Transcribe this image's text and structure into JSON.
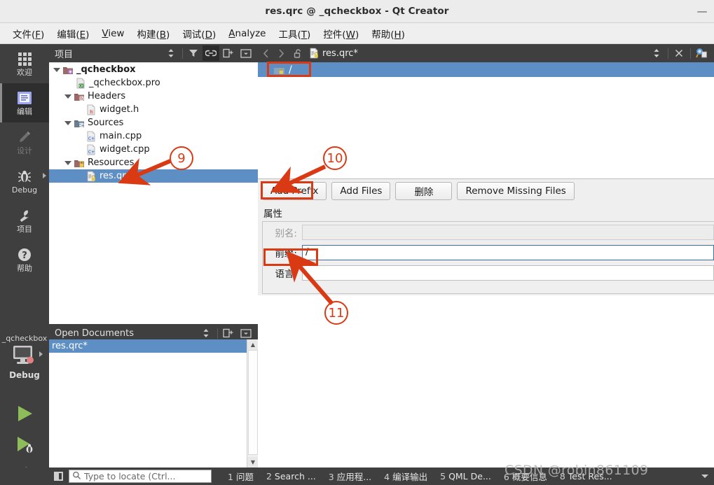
{
  "window": {
    "title": "res.qrc @ _qcheckbox - Qt Creator",
    "minimize_label": "—"
  },
  "menubar": {
    "items": [
      {
        "text": "文件(F)",
        "mnemonic": "F"
      },
      {
        "text": "编辑(E)",
        "mnemonic": "E"
      },
      {
        "text": "View",
        "mnemonic": "V"
      },
      {
        "text": "构建(B)",
        "mnemonic": "B"
      },
      {
        "text": "调试(D)",
        "mnemonic": "D"
      },
      {
        "text": "Analyze",
        "mnemonic": "A"
      },
      {
        "text": "工具(T)",
        "mnemonic": "T"
      },
      {
        "text": "控件(W)",
        "mnemonic": "W"
      },
      {
        "text": "帮助(H)",
        "mnemonic": "H"
      }
    ]
  },
  "modebar": {
    "items": [
      {
        "label": "欢迎",
        "icon": "grid-icon",
        "state": "normal"
      },
      {
        "label": "编辑",
        "icon": "editor-icon",
        "state": "active"
      },
      {
        "label": "设计",
        "icon": "pencil-icon",
        "state": "disabled"
      },
      {
        "label": "Debug",
        "icon": "bug-icon",
        "state": "normal"
      },
      {
        "label": "项目",
        "icon": "wrench-icon",
        "state": "normal"
      },
      {
        "label": "帮助",
        "icon": "question-icon",
        "state": "normal"
      }
    ],
    "kit": {
      "project_name": "_qcheckbox",
      "build_config": "Debug",
      "icon": "desktop-icon"
    },
    "run_buttons": [
      {
        "name": "run-button",
        "icon": "play-icon"
      },
      {
        "name": "debug-button",
        "icon": "play-bug-icon"
      },
      {
        "name": "build-button",
        "icon": "hammer-icon"
      }
    ]
  },
  "project_panel": {
    "title": "项目",
    "toolbar": [
      {
        "name": "sort-selector",
        "icon": "up-down-arrows-icon",
        "active": false
      },
      {
        "name": "filter-button",
        "icon": "filter-icon",
        "active": false
      },
      {
        "name": "sync-with-editor-button",
        "icon": "link-icon",
        "active": true
      },
      {
        "name": "split-button",
        "icon": "split-icon",
        "active": false
      },
      {
        "name": "close-panel-button",
        "icon": "close-split-icon",
        "active": false
      }
    ],
    "tree": [
      {
        "label": "_qcheckbox",
        "depth": 0,
        "icon": "project-folder-icon",
        "expanded": true,
        "bold": true,
        "selected": false
      },
      {
        "label": "_qcheckbox.pro",
        "depth": 1,
        "icon": "qt-pro-file-icon",
        "expanded": null,
        "bold": false,
        "selected": false
      },
      {
        "label": "Headers",
        "depth": 1,
        "icon": "headers-folder-icon",
        "expanded": true,
        "bold": false,
        "selected": false
      },
      {
        "label": "widget.h",
        "depth": 2,
        "icon": "header-file-icon",
        "expanded": null,
        "bold": false,
        "selected": false
      },
      {
        "label": "Sources",
        "depth": 1,
        "icon": "sources-folder-icon",
        "expanded": true,
        "bold": false,
        "selected": false
      },
      {
        "label": "main.cpp",
        "depth": 2,
        "icon": "cpp-file-icon",
        "expanded": null,
        "bold": false,
        "selected": false
      },
      {
        "label": "widget.cpp",
        "depth": 2,
        "icon": "cpp-file-icon",
        "expanded": null,
        "bold": false,
        "selected": false
      },
      {
        "label": "Resources",
        "depth": 1,
        "icon": "resources-folder-icon",
        "expanded": true,
        "bold": false,
        "selected": false
      },
      {
        "label": "res.qrc",
        "depth": 2,
        "icon": "qrc-file-icon",
        "expanded": null,
        "bold": false,
        "selected": true
      }
    ]
  },
  "open_documents": {
    "title": "Open Documents",
    "toolbar": [
      {
        "name": "opendocs-sort-button",
        "icon": "up-down-arrows-icon"
      },
      {
        "name": "opendocs-split-button",
        "icon": "split-icon"
      },
      {
        "name": "opendocs-close-button",
        "icon": "close-split-icon"
      }
    ],
    "documents": [
      {
        "label": "res.qrc*",
        "selected": true
      }
    ]
  },
  "editor": {
    "toolbar": {
      "back_icon": "chevron-left-icon",
      "forward_icon": "chevron-right-icon",
      "lock_icon": "unlocked-icon",
      "file_icon": "qrc-file-icon",
      "filename": "res.qrc*",
      "split_icon": "up-down-arrows-icon",
      "close_icon": "close-icon",
      "extra_icon": "resource-browser-icon"
    },
    "resource_tree": [
      {
        "label": "/",
        "icon": "prefix-folder-icon",
        "selected": true
      }
    ],
    "buttons": [
      {
        "label": "Add Prefix",
        "name": "add-prefix-button",
        "highlighted": true
      },
      {
        "label": "Add Files",
        "name": "add-files-button",
        "highlighted": false
      },
      {
        "label": "删除",
        "name": "remove-button",
        "highlighted": false
      },
      {
        "label": "Remove Missing Files",
        "name": "remove-missing-files-button",
        "highlighted": false
      }
    ],
    "properties": {
      "group_title": "属性",
      "fields": [
        {
          "label": "别名:",
          "value": "",
          "name": "alias-field",
          "disabled": true,
          "focused": false
        },
        {
          "label": "前缀:",
          "value": "/",
          "name": "prefix-field",
          "disabled": false,
          "focused": true
        },
        {
          "label": "语言:",
          "value": "",
          "name": "language-field",
          "disabled": false,
          "focused": false
        }
      ]
    }
  },
  "statusbar": {
    "toggle_sidebar_name": "toggle-sidebar-button",
    "locator": {
      "icon": "search-icon",
      "placeholder": "Type to locate (Ctrl...",
      "value": ""
    },
    "panes": [
      {
        "num": "1",
        "label": "问题"
      },
      {
        "num": "2",
        "label": "Search ..."
      },
      {
        "num": "3",
        "label": "应用程..."
      },
      {
        "num": "4",
        "label": "编译输出"
      },
      {
        "num": "5",
        "label": "QML De..."
      },
      {
        "num": "6",
        "label": "概要信息"
      },
      {
        "num": "8",
        "label": "Test Res..."
      }
    ]
  },
  "watermark": {
    "text": "CSDN @robin861109"
  },
  "annotations": {
    "accent_color": "#d93a14",
    "markers": [
      {
        "number": "9",
        "target": "res-qrc-tree-item"
      },
      {
        "number": "10",
        "target": "add-prefix-button"
      },
      {
        "number": "11",
        "target": "prefix-field"
      }
    ],
    "boxes": [
      {
        "name": "prefix-root-row-box"
      },
      {
        "name": "add-prefix-button-box"
      },
      {
        "name": "prefix-field-box"
      }
    ]
  }
}
